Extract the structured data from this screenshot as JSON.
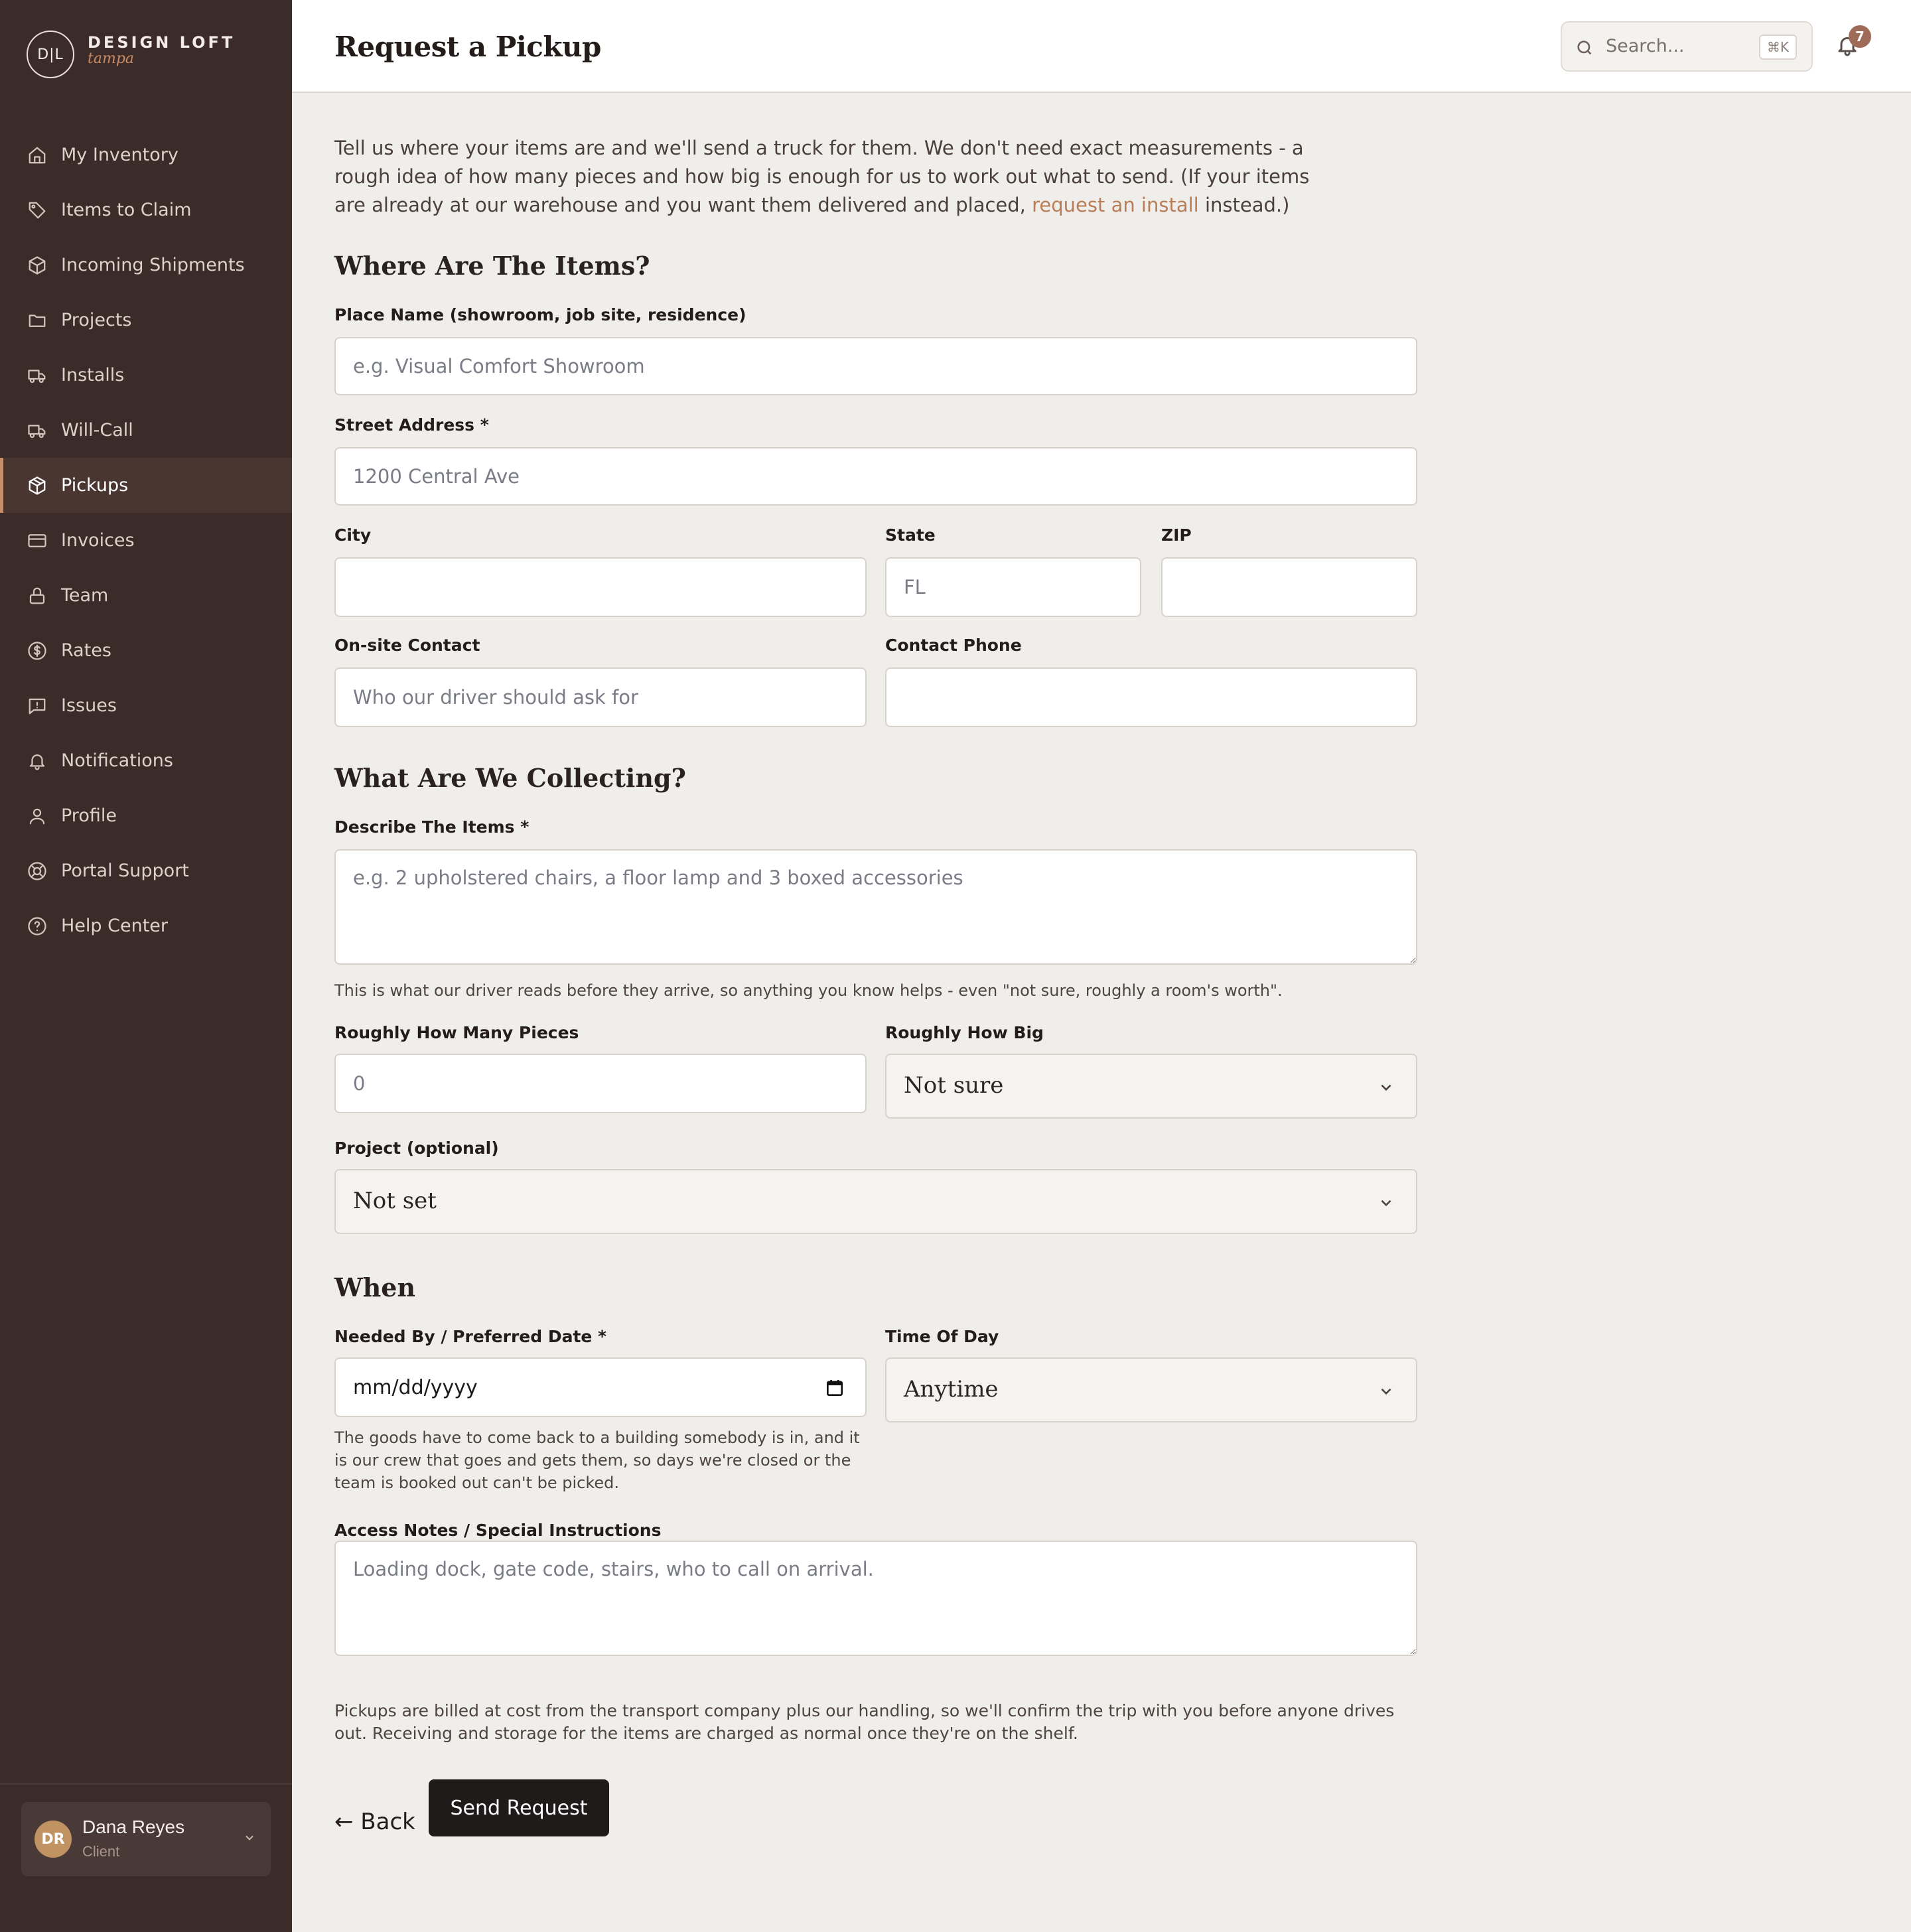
{
  "brand": {
    "monogram": "D|L",
    "name": "DESIGN LOFT",
    "tagline": "tampa"
  },
  "sidebar": {
    "items": [
      {
        "label": "My Inventory",
        "icon": "home-icon"
      },
      {
        "label": "Items to Claim",
        "icon": "tag-icon"
      },
      {
        "label": "Incoming Shipments",
        "icon": "box-icon"
      },
      {
        "label": "Projects",
        "icon": "folder-icon"
      },
      {
        "label": "Installs",
        "icon": "truck-icon"
      },
      {
        "label": "Will-Call",
        "icon": "truck-icon"
      },
      {
        "label": "Pickups",
        "icon": "package-icon",
        "active": true
      },
      {
        "label": "Invoices",
        "icon": "card-icon"
      },
      {
        "label": "Team",
        "icon": "lock-icon"
      },
      {
        "label": "Rates",
        "icon": "dollar-icon"
      },
      {
        "label": "Issues",
        "icon": "message-icon"
      },
      {
        "label": "Notifications",
        "icon": "bell-icon"
      },
      {
        "label": "Profile",
        "icon": "user-icon"
      },
      {
        "label": "Portal Support",
        "icon": "lifebuoy-icon"
      },
      {
        "label": "Help Center",
        "icon": "help-circle-icon"
      }
    ],
    "user": {
      "initials": "DR",
      "name": "Dana Reyes",
      "role": "Client"
    }
  },
  "header": {
    "title": "Request a Pickup",
    "search_placeholder": "Search...",
    "search_shortcut": "⌘K",
    "notification_count": "7"
  },
  "intro": {
    "text_before": "Tell us where your items are and we'll send a truck for them. We don't need exact measurements - a rough idea of how many pieces and how big is enough for us to work out what to send. (If your items are already at our warehouse and you want them delivered and placed, ",
    "link": "request an install",
    "text_after": " instead.)"
  },
  "where": {
    "section_title": "Where Are The Items?",
    "place_name_label": "Place Name (showroom, job site, residence)",
    "place_name_placeholder": "e.g. Visual Comfort Showroom",
    "street_label": "Street Address *",
    "street_placeholder": "1200 Central Ave",
    "city_label": "City",
    "city_value": "",
    "state_label": "State",
    "state_placeholder": "FL",
    "zip_label": "ZIP",
    "zip_value": "",
    "contact_label": "On-site Contact",
    "contact_placeholder": "Who our driver should ask for",
    "phone_label": "Contact Phone",
    "phone_value": ""
  },
  "what": {
    "section_title": "What Are We Collecting?",
    "describe_label": "Describe The Items *",
    "describe_placeholder": "e.g. 2 upholstered chairs, a floor lamp and 3 boxed accessories",
    "describe_help": "This is what our driver reads before they arrive, so anything you know helps - even \"not sure, roughly a room's worth\".",
    "pieces_label": "Roughly How Many Pieces",
    "pieces_placeholder": "0",
    "size_label": "Roughly How Big",
    "size_value": "Not sure",
    "project_label": "Project (optional)",
    "project_value": "Not set"
  },
  "when": {
    "section_title": "When",
    "date_label": "Needed By / Preferred Date *",
    "date_placeholder": "mm/dd/yyyy",
    "date_help": "The goods have to come back to a building somebody is in, and it is our crew that goes and gets them, so days we're closed or the team is booked out can't be picked.",
    "time_label": "Time Of Day",
    "time_value": "Anytime",
    "notes_label": "Access Notes / Special Instructions",
    "notes_placeholder": "Loading dock, gate code, stairs, who to call on arrival."
  },
  "footer": {
    "billing_note": "Pickups are billed at cost from the transport company plus our handling, so we'll confirm the trip with you before anyone drives out. Receiving and storage for the items are charged as normal once they're on the shelf.",
    "back_label": "← Back",
    "submit_label": "Send Request"
  },
  "colors": {
    "sidebar_bg": "#3b2c2a",
    "accent": "#c58f6c",
    "link": "#b97e57",
    "page_bg": "#f0eeea",
    "button_bg": "#1e1b1a"
  }
}
